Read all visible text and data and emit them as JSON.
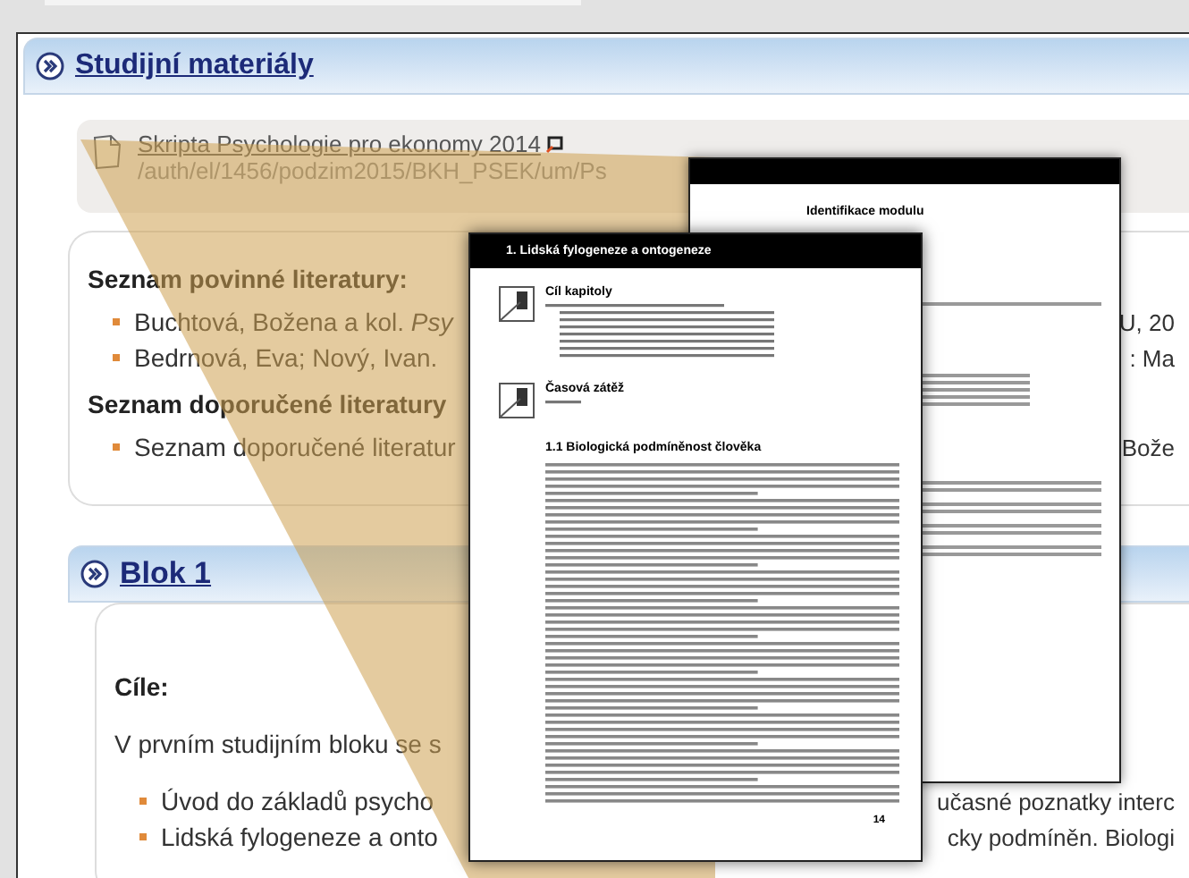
{
  "section": {
    "title": "Studijní materiály",
    "file": {
      "name": "Skripta Psychologie pro ekonomy 2014",
      "path": "/auth/el/1456/podzim2015/BKH_PSEK/um/Ps"
    },
    "lists": [
      {
        "heading": "Seznam povinné literatury:",
        "items": [
          {
            "text": "Buchtová, Božena a kol. *Psy*",
            "tail": "U, 20"
          },
          {
            "text": "Bedrnová, Eva; Nový, Ivan.",
            "tail": ": Ma"
          }
        ]
      },
      {
        "heading": "Seznam doporučené literatury",
        "items": [
          {
            "text": "Seznam doporučené literatur",
            "tail": "Bože"
          }
        ]
      }
    ]
  },
  "block": {
    "title": "Blok 1",
    "goals_heading": "Cíle:",
    "intro": "V prvním studijním bloku se s",
    "items": [
      {
        "text": "Úvod do základů psycho",
        "tail": "učasné poznatky interc"
      },
      {
        "text": "Lidská fylogeneze a onto",
        "tail": "cky podmíněn. Biologi"
      }
    ]
  },
  "preview": {
    "back_page": {
      "heading": "Identifikace modulu"
    },
    "front_page": {
      "header": "1. Lidská fylogeneze a ontogeneze",
      "sections": [
        {
          "title": "Cíl kapitoly"
        },
        {
          "title": "Časová zátěž"
        }
      ],
      "subheading": "1.1 Biologická podmíněnost člověka",
      "page_number": "14"
    }
  }
}
